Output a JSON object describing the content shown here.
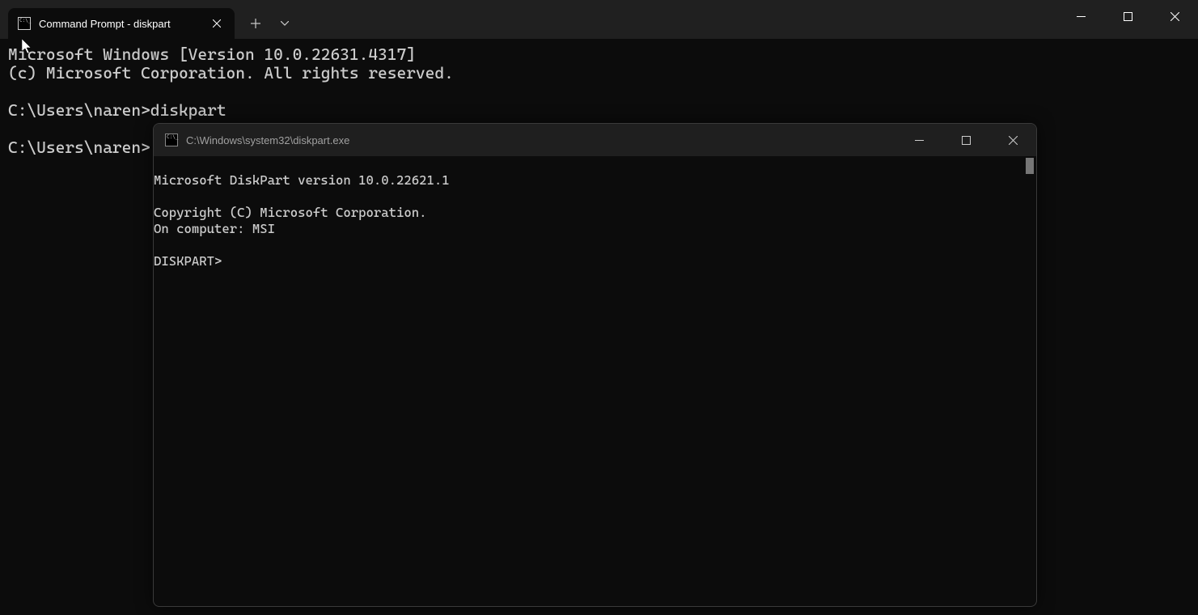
{
  "window": {
    "tab": {
      "title": "Command Prompt - diskpart"
    },
    "terminal_lines": [
      "Microsoft Windows [Version 10.0.22631.4317]",
      "(c) Microsoft Corporation. All rights reserved.",
      "",
      "C:\\Users\\naren>diskpart",
      "",
      "C:\\Users\\naren>"
    ]
  },
  "child": {
    "title": "C:\\Windows\\system32\\diskpart.exe",
    "lines": [
      "",
      "Microsoft DiskPart version 10.0.22621.1",
      "",
      "Copyright (C) Microsoft Corporation.",
      "On computer: MSI",
      "",
      "DISKPART>"
    ]
  }
}
